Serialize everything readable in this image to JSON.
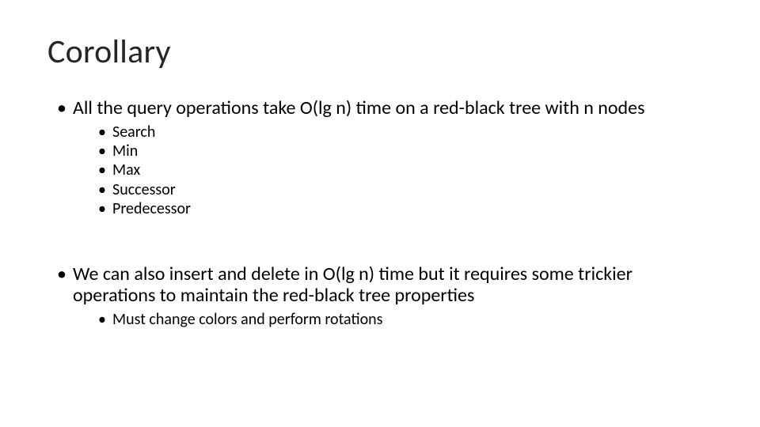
{
  "title": "Corollary",
  "bullets": [
    {
      "text": "All the query operations take O(lg n) time on a red-black tree with n nodes",
      "children": [
        "Search",
        "Min",
        "Max",
        "Successor",
        "Predecessor"
      ]
    },
    {
      "text": "We can also insert and delete in O(lg n) time but it requires some trickier operations to maintain the red-black tree properties",
      "children": [
        "Must change colors and perform rotations"
      ]
    }
  ]
}
